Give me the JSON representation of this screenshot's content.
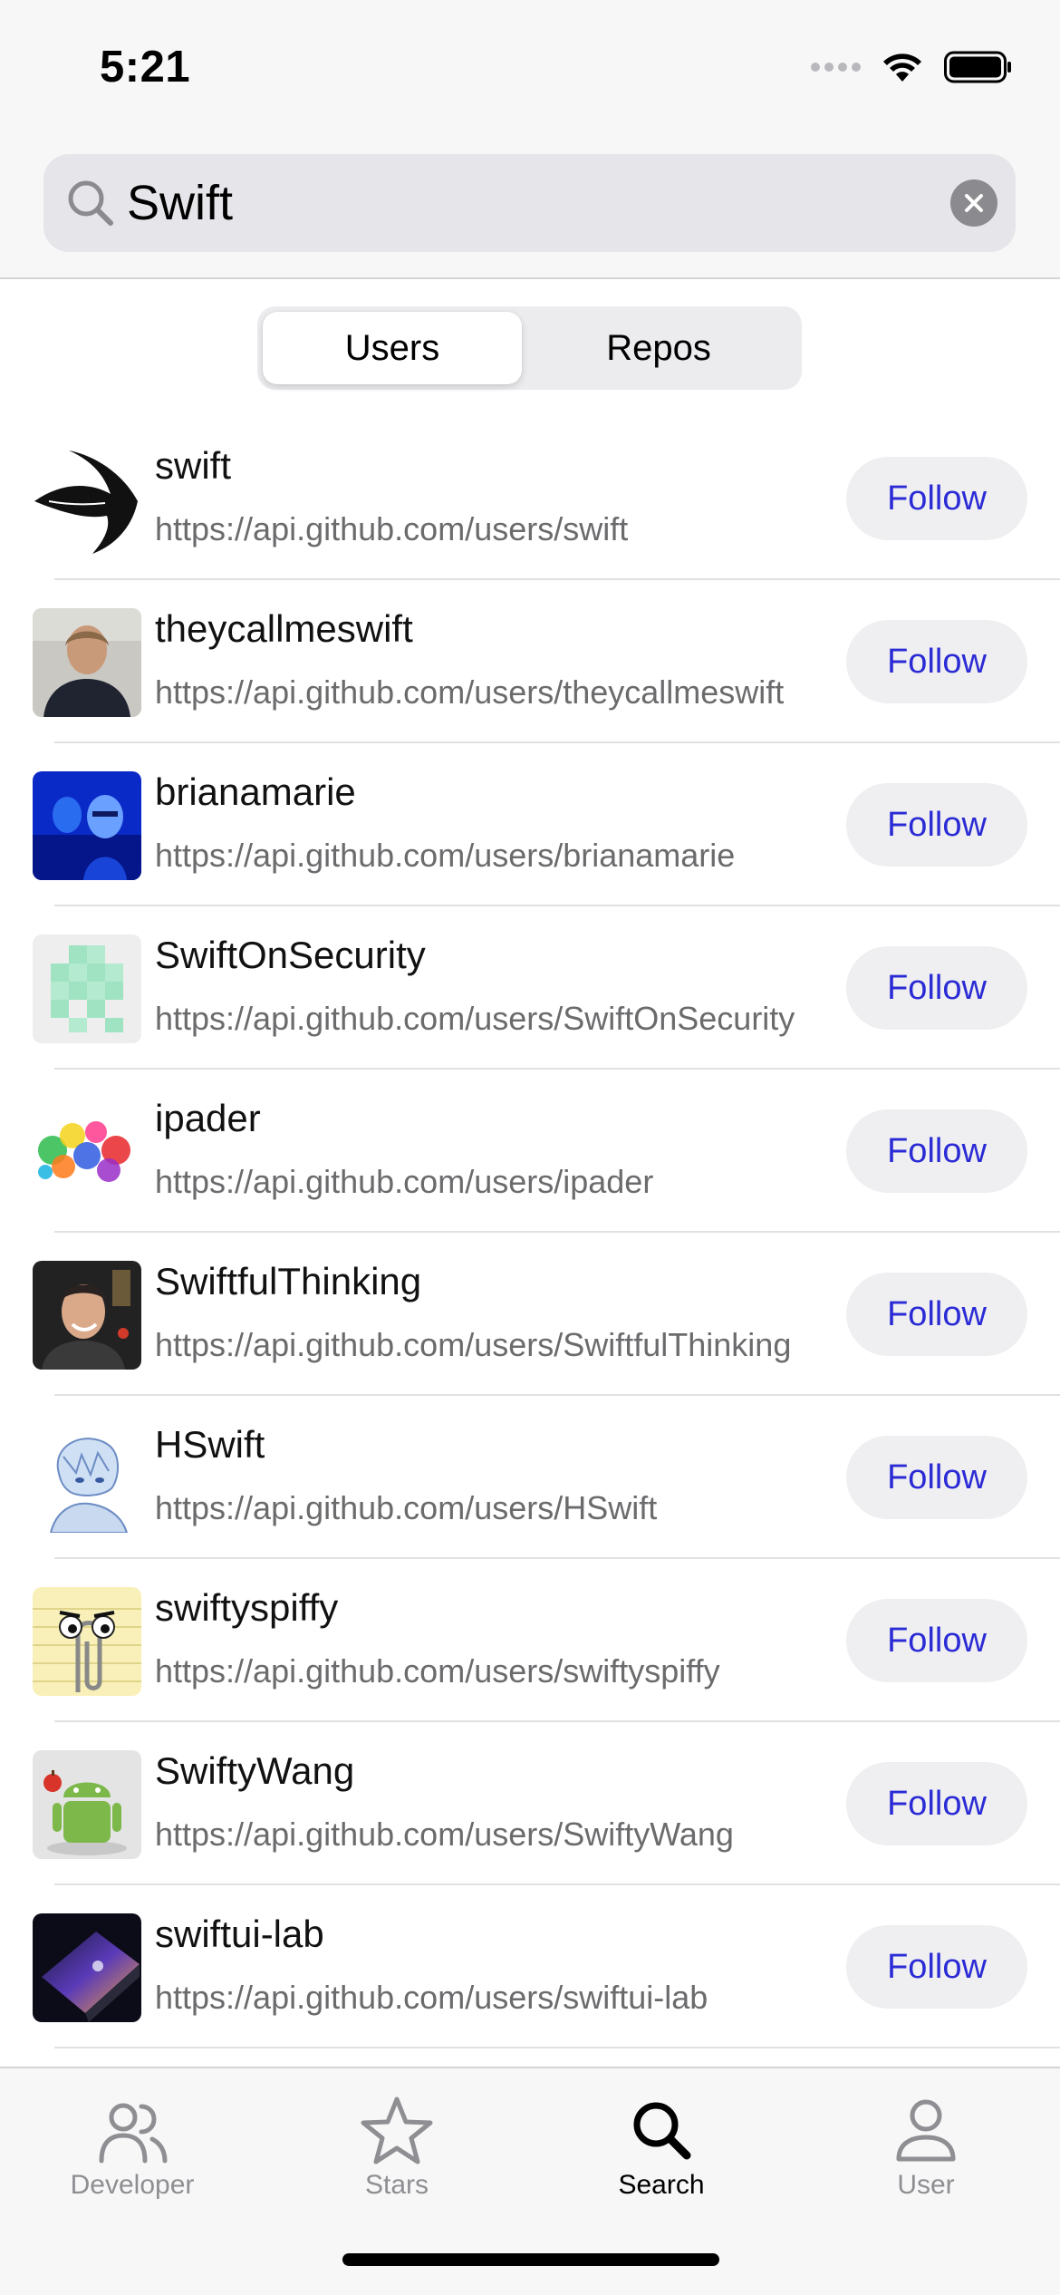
{
  "status_bar": {
    "time": "5:21",
    "icons": [
      "cellular-signal-icon",
      "wifi-icon",
      "battery-icon"
    ]
  },
  "search": {
    "value": "Swift",
    "placeholder": "",
    "icon": "search-icon",
    "clear_icon": "clear-icon"
  },
  "segments": {
    "users": "Users",
    "repos": "Repos",
    "selected": "Users"
  },
  "users": [
    {
      "name": "swift",
      "url": "https://api.github.com/users/swift",
      "follow": "Follow"
    },
    {
      "name": "theycallmeswift",
      "url": "https://api.github.com/users/theycallmeswift",
      "follow": "Follow"
    },
    {
      "name": "brianamarie",
      "url": "https://api.github.com/users/brianamarie",
      "follow": "Follow"
    },
    {
      "name": "SwiftOnSecurity",
      "url": "https://api.github.com/users/SwiftOnSecurity",
      "follow": "Follow"
    },
    {
      "name": "ipader",
      "url": "https://api.github.com/users/ipader",
      "follow": "Follow"
    },
    {
      "name": "SwiftfulThinking",
      "url": "https://api.github.com/users/SwiftfulThinking",
      "follow": "Follow"
    },
    {
      "name": "HSwift",
      "url": "https://api.github.com/users/HSwift",
      "follow": "Follow"
    },
    {
      "name": "swiftyspiffy",
      "url": "https://api.github.com/users/swiftyspiffy",
      "follow": "Follow"
    },
    {
      "name": "SwiftyWang",
      "url": "https://api.github.com/users/SwiftyWang",
      "follow": "Follow"
    },
    {
      "name": "swiftui-lab",
      "url": "https://api.github.com/users/swiftui-lab",
      "follow": "Follow"
    }
  ],
  "tabbar": {
    "items": [
      {
        "label": "Developer",
        "icon": "people-icon"
      },
      {
        "label": "Stars",
        "icon": "star-icon"
      },
      {
        "label": "Search",
        "icon": "search-icon"
      },
      {
        "label": "User",
        "icon": "person-icon"
      }
    ],
    "selected": "Search"
  },
  "colors": {
    "accent": "#2b2bd6",
    "header_bg": "#f7f7f7",
    "search_field_bg": "#e6e6ea",
    "follow_bg": "#efeff1",
    "secondary_text": "#6b6b6e",
    "inactive_tab": "#8e8e93"
  }
}
